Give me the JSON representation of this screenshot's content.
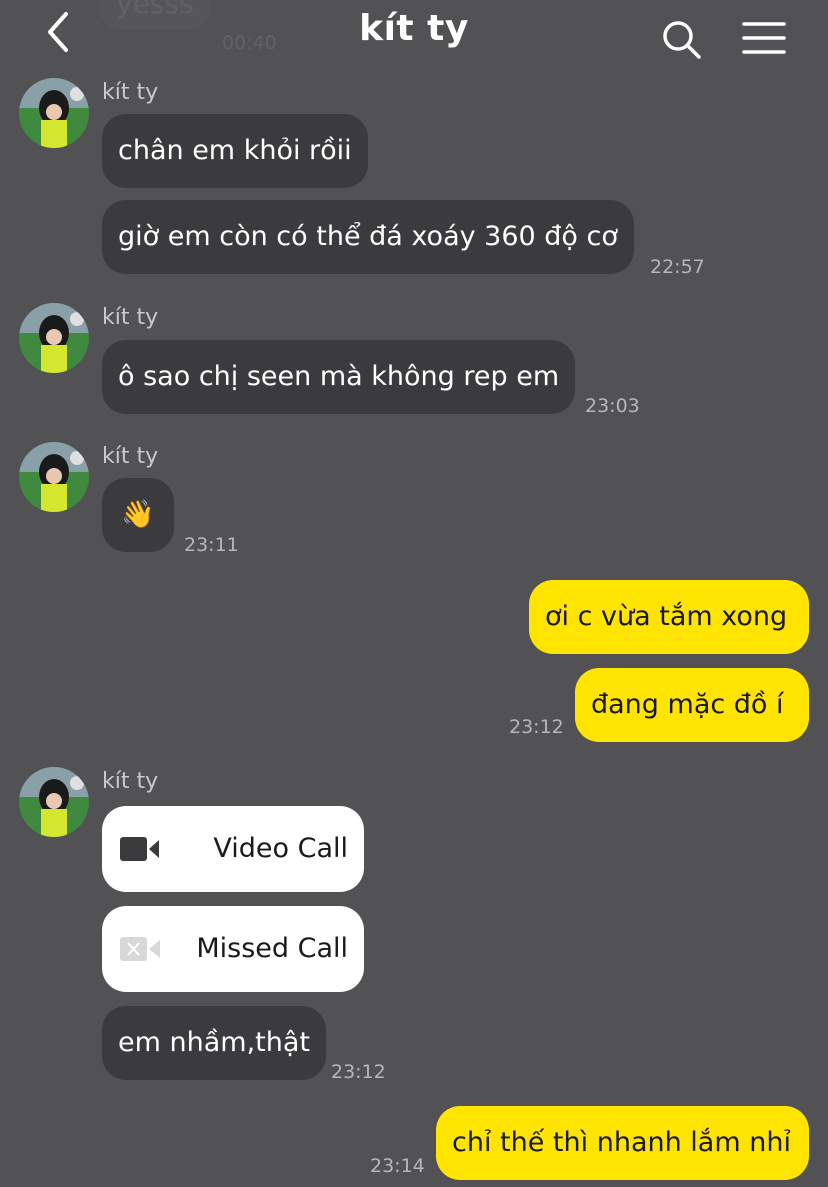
{
  "header": {
    "title": "kít ty",
    "ghost_message": "yesss",
    "ghost_time": "00:40",
    "back_icon": "chevron-left-icon",
    "search_icon": "search-icon",
    "menu_icon": "hamburger-menu-icon"
  },
  "contact_name": "kít ty",
  "messages": {
    "m1": "chân em khỏi rồii",
    "m2": "giờ em còn có thể đá xoáy 360 độ cơ",
    "t2": "22:57",
    "m3": "ô sao chị seen mà không rep em",
    "t3": "23:03",
    "m4": "👋",
    "t4": "23:11",
    "m5": "ơi c vừa tắm xong",
    "m6": "đang mặc đồ í",
    "t6": "23:12",
    "call1": "Video Call",
    "call2": "Missed Call",
    "m7": "em nhầm,thật",
    "t7": "23:12",
    "m8": "chỉ thế thì nhanh lắm nhỉ",
    "t8": "23:14"
  },
  "colors": {
    "background": "#525154",
    "incoming_bubble": "#3b3a3d",
    "outgoing_bubble": "#ffe400",
    "call_card": "#ffffff"
  }
}
